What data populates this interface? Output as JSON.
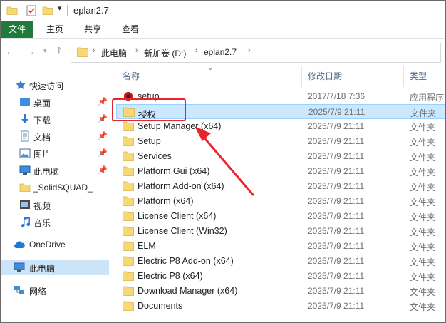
{
  "window": {
    "title": "eplan2.7"
  },
  "ribbon": {
    "tabs": [
      {
        "label": "文件"
      },
      {
        "label": "主页"
      },
      {
        "label": "共享"
      },
      {
        "label": "查看"
      }
    ]
  },
  "address": {
    "crumbs": [
      "此电脑",
      "新加卷 (D:)",
      "eplan2.7"
    ]
  },
  "sidebar": {
    "quick_access": "快速访问",
    "items": [
      {
        "label": "桌面",
        "icon": "desktop-icon",
        "pinned": true
      },
      {
        "label": "下载",
        "icon": "download-icon",
        "pinned": true
      },
      {
        "label": "文档",
        "icon": "documents-icon",
        "pinned": true
      },
      {
        "label": "图片",
        "icon": "pictures-icon",
        "pinned": true
      },
      {
        "label": "此电脑",
        "icon": "computer-icon",
        "pinned": true
      },
      {
        "label": "_SolidSQUAD_",
        "icon": "folder-icon",
        "pinned": false
      },
      {
        "label": "视频",
        "icon": "video-icon",
        "pinned": false
      },
      {
        "label": "音乐",
        "icon": "music-icon",
        "pinned": false
      }
    ],
    "onedrive": "OneDrive",
    "this_pc": "此电脑",
    "network": "网络"
  },
  "columns": {
    "name": "名称",
    "date": "修改日期",
    "type": "类型"
  },
  "files": [
    {
      "name": "setup",
      "date": "2017/7/18 7:36",
      "type": "应用程序",
      "icon": "app-icon"
    },
    {
      "name": "授权",
      "date": "2025/7/9 21:11",
      "type": "文件夹",
      "icon": "folder-icon"
    },
    {
      "name": "Setup Manager (x64)",
      "date": "2025/7/9 21:11",
      "type": "文件夹",
      "icon": "folder-icon"
    },
    {
      "name": "Setup",
      "date": "2025/7/9 21:11",
      "type": "文件夹",
      "icon": "folder-icon"
    },
    {
      "name": "Services",
      "date": "2025/7/9 21:11",
      "type": "文件夹",
      "icon": "folder-icon"
    },
    {
      "name": "Platform Gui (x64)",
      "date": "2025/7/9 21:11",
      "type": "文件夹",
      "icon": "folder-icon"
    },
    {
      "name": "Platform Add-on (x64)",
      "date": "2025/7/9 21:11",
      "type": "文件夹",
      "icon": "folder-icon"
    },
    {
      "name": "Platform (x64)",
      "date": "2025/7/9 21:11",
      "type": "文件夹",
      "icon": "folder-icon"
    },
    {
      "name": "License Client (x64)",
      "date": "2025/7/9 21:11",
      "type": "文件夹",
      "icon": "folder-icon"
    },
    {
      "name": "License Client (Win32)",
      "date": "2025/7/9 21:11",
      "type": "文件夹",
      "icon": "folder-icon"
    },
    {
      "name": "ELM",
      "date": "2025/7/9 21:11",
      "type": "文件夹",
      "icon": "folder-icon"
    },
    {
      "name": "Electric P8 Add-on (x64)",
      "date": "2025/7/9 21:11",
      "type": "文件夹",
      "icon": "folder-icon"
    },
    {
      "name": "Electric P8 (x64)",
      "date": "2025/7/9 21:11",
      "type": "文件夹",
      "icon": "folder-icon"
    },
    {
      "name": "Download Manager (x64)",
      "date": "2025/7/9 21:11",
      "type": "文件夹",
      "icon": "folder-icon"
    },
    {
      "name": "Documents",
      "date": "2025/7/9 21:11",
      "type": "文件夹",
      "icon": "folder-icon"
    }
  ],
  "selected_index": 1,
  "colors": {
    "file_tab": "#1f7a3c",
    "selection": "#cce8ff",
    "annotation": "#e8242c",
    "folder": "#f8d775"
  }
}
